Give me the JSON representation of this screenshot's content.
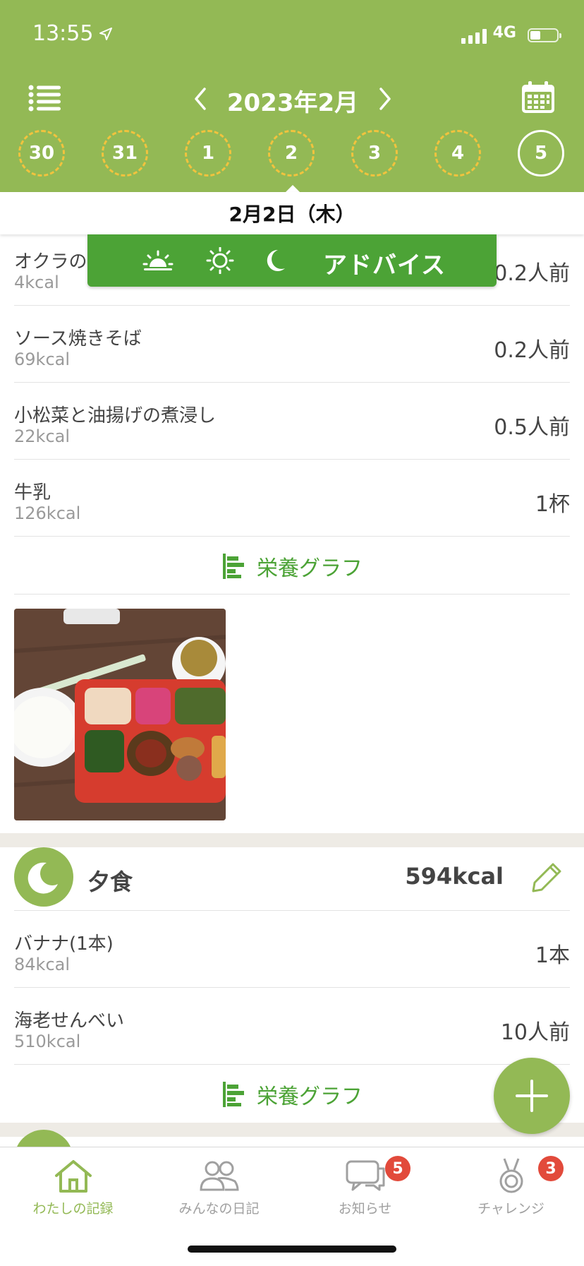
{
  "status": {
    "time": "13:55",
    "network": "4G"
  },
  "header": {
    "month_label": "2023年2月"
  },
  "days": [
    "30",
    "31",
    "1",
    "2",
    "3",
    "4",
    "5"
  ],
  "selected_date": "2月2日（木）",
  "meal_tabs": {
    "advice_label": "アドバイス"
  },
  "lunch_items": [
    {
      "name": "オクラの",
      "kcal": "4kcal",
      "qty": "0.2人前"
    },
    {
      "name": "ソース焼きそば",
      "kcal": "69kcal",
      "qty": "0.2人前"
    },
    {
      "name": "小松菜と油揚げの煮浸し",
      "kcal": "22kcal",
      "qty": "0.5人前"
    },
    {
      "name": "牛乳",
      "kcal": "126kcal",
      "qty": "1杯"
    }
  ],
  "nutrition_graph_label": "栄養グラフ",
  "dinner": {
    "name": "夕食",
    "kcal": "594kcal",
    "items": [
      {
        "name": "バナナ(1本)",
        "kcal": "84kcal",
        "qty": "1本"
      },
      {
        "name": "海老せんべい",
        "kcal": "510kcal",
        "qty": "10人前"
      }
    ]
  },
  "bottom_nav": [
    {
      "label": "わたしの記録",
      "icon": "home-icon",
      "badge": ""
    },
    {
      "label": "みんなの日記",
      "icon": "people-icon",
      "badge": ""
    },
    {
      "label": "お知らせ",
      "icon": "chat-icon",
      "badge": "5"
    },
    {
      "label": "チャレンジ",
      "icon": "medal-icon",
      "badge": "3"
    }
  ],
  "colors": {
    "brand_green": "#93b955",
    "tab_green": "#4ca336",
    "ring_yellow": "#f1c33e",
    "badge_red": "#e24a3b"
  }
}
